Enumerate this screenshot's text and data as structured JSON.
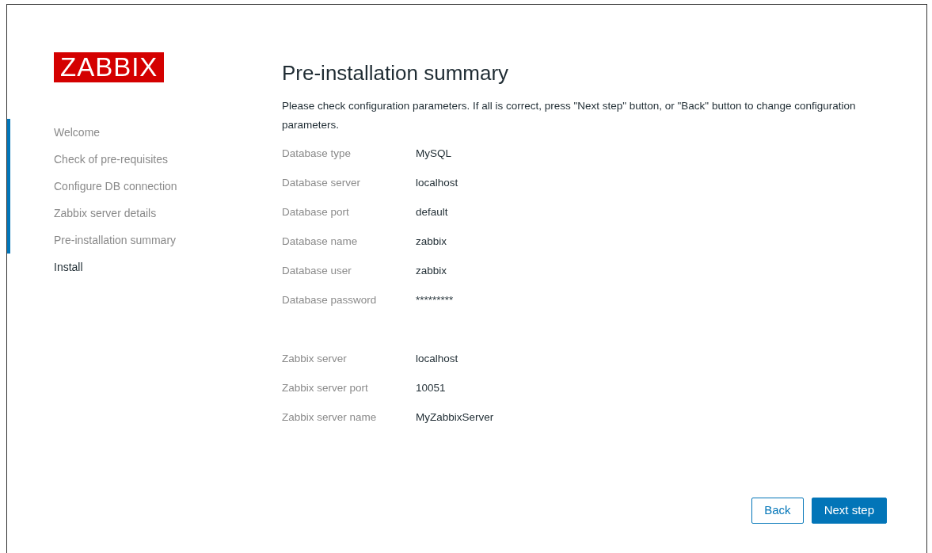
{
  "logo": {
    "text": "ZABBIX"
  },
  "steps": [
    {
      "label": "Welcome",
      "done": true,
      "selected": false
    },
    {
      "label": "Check of pre-requisites",
      "done": true,
      "selected": false
    },
    {
      "label": "Configure DB connection",
      "done": true,
      "selected": false
    },
    {
      "label": "Zabbix server details",
      "done": true,
      "selected": false
    },
    {
      "label": "Pre-installation summary",
      "done": true,
      "selected": false
    },
    {
      "label": "Install",
      "done": false,
      "selected": true
    }
  ],
  "title": "Pre-installation summary",
  "description": "Please check configuration parameters. If all is correct, press \"Next step\" button, or \"Back\" button to change configuration parameters.",
  "summary_groups": [
    {
      "rows": [
        {
          "label": "Database type",
          "value": "MySQL"
        },
        {
          "label": "Database server",
          "value": "localhost"
        },
        {
          "label": "Database port",
          "value": "default"
        },
        {
          "label": "Database name",
          "value": "zabbix"
        },
        {
          "label": "Database user",
          "value": "zabbix"
        },
        {
          "label": "Database password",
          "value": "*********"
        }
      ]
    },
    {
      "rows": [
        {
          "label": "Zabbix server",
          "value": "localhost"
        },
        {
          "label": "Zabbix server port",
          "value": "10051"
        },
        {
          "label": "Zabbix server name",
          "value": "MyZabbixServer"
        }
      ]
    }
  ],
  "buttons": [
    {
      "label": "Back",
      "kind": "secondary"
    },
    {
      "label": "Next step",
      "kind": "primary"
    }
  ]
}
